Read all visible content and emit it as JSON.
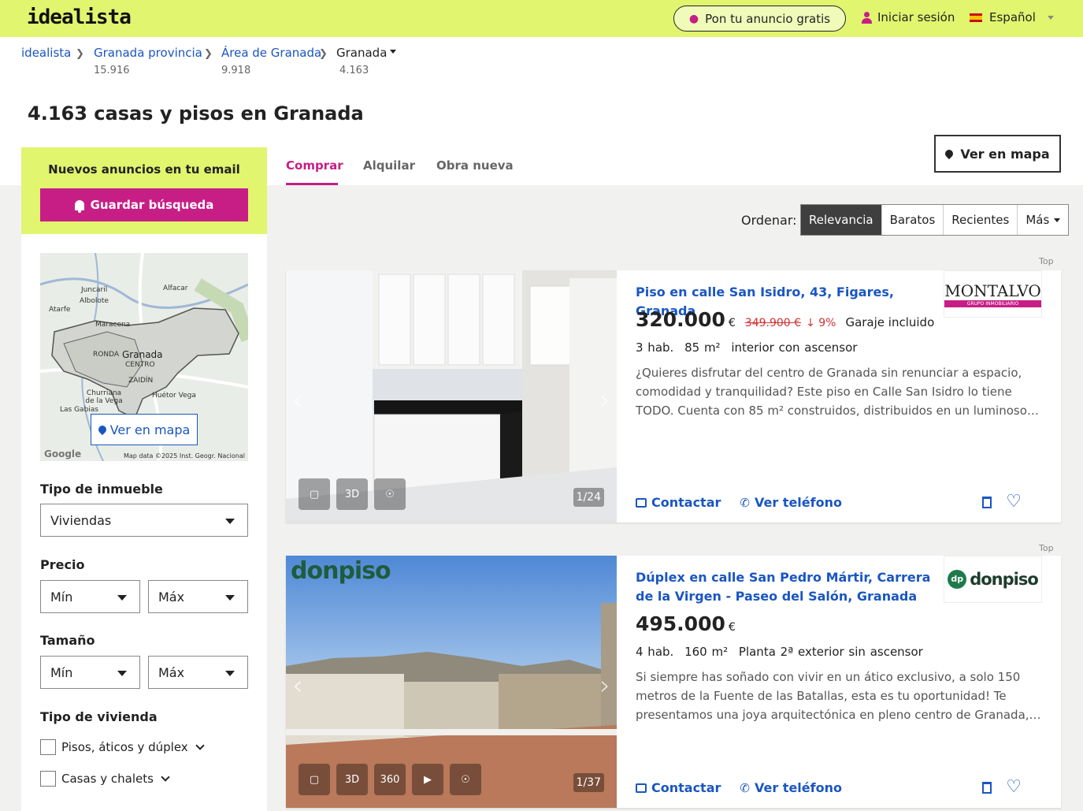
{
  "header": {
    "logo": "idealista",
    "post_ad": "Pon tu anuncio gratis",
    "login": "Iniciar sesión",
    "language": "Español"
  },
  "breadcrumb": [
    {
      "label": "idealista",
      "count": ""
    },
    {
      "label": "Granada provincia",
      "count": "15.916"
    },
    {
      "label": "Área de Granada",
      "count": "9.918"
    },
    {
      "label": "Granada",
      "count": "4.163"
    }
  ],
  "page_title": "4.163 casas y pisos en Granada",
  "sidebar": {
    "alert_title": "Nuevos anuncios en tu email",
    "save_search": "Guardar búsqueda",
    "map_button": "Ver en mapa",
    "map_attribution": "Map data ©2025 Inst. Geogr. Nacional",
    "map_logo": "Google",
    "map_labels": [
      "Juncaril",
      "Albolote",
      "Alfacar",
      "Atarfe",
      "Maracena",
      "RONDA",
      "Granada",
      "CENTRO",
      "ZAIDÍN",
      "Churriana de la Vega",
      "Huétor Vega",
      "Las Gabias"
    ],
    "property_type_label": "Tipo de inmueble",
    "property_type_value": "Viviendas",
    "price_label": "Precio",
    "price_min": "Mín",
    "price_max": "Máx",
    "size_label": "Tamaño",
    "size_min": "Mín",
    "size_max": "Máx",
    "housing_type_label": "Tipo de vivienda",
    "housing_options": [
      "Pisos, áticos y dúplex",
      "Casas y chalets"
    ]
  },
  "tabs": [
    "Comprar",
    "Alquilar",
    "Obra nueva"
  ],
  "view_map": "Ver en mapa",
  "sort": {
    "label": "Ordenar:",
    "options": [
      "Relevancia",
      "Baratos",
      "Recientes",
      "Más"
    ]
  },
  "listings": [
    {
      "tag": "Top",
      "title": "Piso en calle San Isidro, 43, Figares, Granada",
      "price": "320.000",
      "currency": "€",
      "old_price": "349.900 €",
      "drop": "↓ 9%",
      "extra": "Garaje incluido",
      "details": [
        "3 hab.",
        "85 m²",
        "interior con ascensor"
      ],
      "description": "¿Quieres disfrutar del centro de Granada sin renunciar a espacio, comodidad y tranquilidad? Este piso en Calle San Isidro lo tiene TODO. Cuenta con 85 m² construidos, distribuidos en un luminoso salón, tres habitaciones",
      "photo_count": "1/24",
      "photo_icons": [
        "floorplan-icon",
        "3d-icon",
        "location-icon"
      ],
      "brand": "MONTALVO",
      "brand_sub": "GRUPO INMOBILIARIO",
      "contact": "Contactar",
      "phone": "Ver teléfono"
    },
    {
      "tag": "Top",
      "title": "Dúplex en calle San Pedro Mártir, Carrera de la Virgen - Paseo del Salón, Granada",
      "price": "495.000",
      "currency": "€",
      "details": [
        "4 hab.",
        "160 m²",
        "Planta 2ª exterior sin ascensor"
      ],
      "description": "Si siempre has soñado con vivir en un ático exclusivo, a solo 150 metros de la Fuente de las Batallas, esta es tu oportunidad! Te presentamos una joya arquitectónica en pleno centro de Granada, donde el diseño, la luz",
      "photo_count": "1/37",
      "photo_icons": [
        "floorplan-icon",
        "3d-icon",
        "360-icon",
        "video-icon",
        "location-icon"
      ],
      "photo_watermark": "donpiso",
      "brand": "donpiso",
      "brand_badge": "dp",
      "contact": "Contactar",
      "phone": "Ver teléfono"
    }
  ],
  "colors": {
    "brand_yellow": "#e1f56e",
    "accent_magenta": "#c71e86",
    "link_blue": "#1a56c2",
    "price_drop_red": "#d23232"
  }
}
